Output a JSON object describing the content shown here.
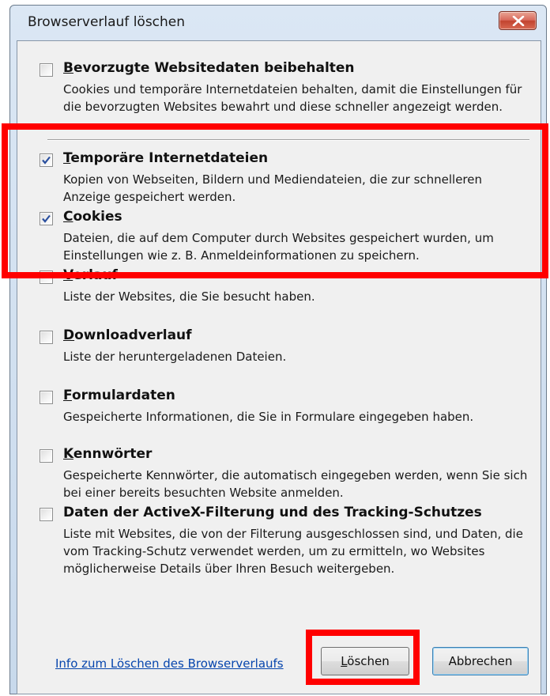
{
  "window": {
    "title": "Browserverlauf löschen"
  },
  "options": [
    {
      "title_underline": "B",
      "title_rest": "evorzugte Websitedaten beibehalten",
      "description": "Cookies und temporäre Internetdateien behalten, damit die Einstellungen für die bevorzugten Websites bewahrt und diese schneller angezeigt werden.",
      "checked": false
    },
    {
      "title_underline": "T",
      "title_rest": "emporäre Internetdateien",
      "description": "Kopien von Webseiten, Bildern und Mediendateien, die zur schnelleren Anzeige gespeichert werden.",
      "checked": true
    },
    {
      "title_underline": "C",
      "title_rest": "ookies",
      "description": "Dateien, die auf dem Computer durch Websites gespeichert wurden, um Einstellungen wie z. B. Anmeldeinformationen zu speichern.",
      "checked": true
    },
    {
      "title_underline": "V",
      "title_rest": "erlauf",
      "description": "Liste der Websites, die Sie besucht haben.",
      "checked": false
    },
    {
      "title_underline": "D",
      "title_rest": "ownloadverlauf",
      "description": "Liste der heruntergeladenen Dateien.",
      "checked": false
    },
    {
      "title_underline": "F",
      "title_rest": "ormulardaten",
      "description": "Gespeicherte Informationen, die Sie in Formulare eingegeben haben.",
      "checked": false
    },
    {
      "title_underline": "K",
      "title_rest": "ennwörter",
      "description": "Gespeicherte Kennwörter, die automatisch eingegeben werden, wenn Sie sich bei einer bereits besuchten Website anmelden.",
      "checked": false
    },
    {
      "title_underline": "",
      "title_rest": "Daten der ActiveX-Filterung und des Tracking-Schutzes",
      "description": "Liste mit Websites, die von der Filterung ausgeschlossen sind, und Daten, die vom Tracking-Schutz verwendet werden, um zu ermitteln, wo Websites möglicherweise Details über Ihren Besuch weitergeben.",
      "checked": false
    }
  ],
  "footer": {
    "info_link": "Info zum Löschen des Browserverlaufs",
    "delete_underline": "L",
    "delete_rest": "öschen",
    "cancel_label": "Abbrechen"
  },
  "colors": {
    "highlight": "#ff0000",
    "link": "#0645ad"
  },
  "icons": {
    "close": "close-x-icon",
    "check": "checkmark-icon"
  }
}
